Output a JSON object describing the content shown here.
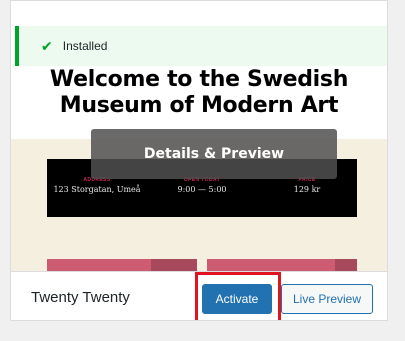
{
  "notice": {
    "icon": "checkmark-icon",
    "text": "Installed",
    "color": "#00a32a"
  },
  "preview": {
    "title_line1": "Welcome to the Swedish",
    "title_line2": "Museum of Modern Art",
    "details_button": "Details & Preview",
    "info_band": [
      {
        "label": "ADDRESS",
        "value": "123 Storgatan, Umeå"
      },
      {
        "label": "OPEN TODAY",
        "value": "9:00 — 5:00"
      },
      {
        "label": "PRICE",
        "value": "129 kr"
      }
    ],
    "accent_color": "#cd2653"
  },
  "footer": {
    "theme_name": "Twenty Twenty",
    "activate_label": "Activate",
    "live_preview_label": "Live Preview",
    "primary_color": "#2271b1",
    "highlight_color": "#e0141e"
  }
}
